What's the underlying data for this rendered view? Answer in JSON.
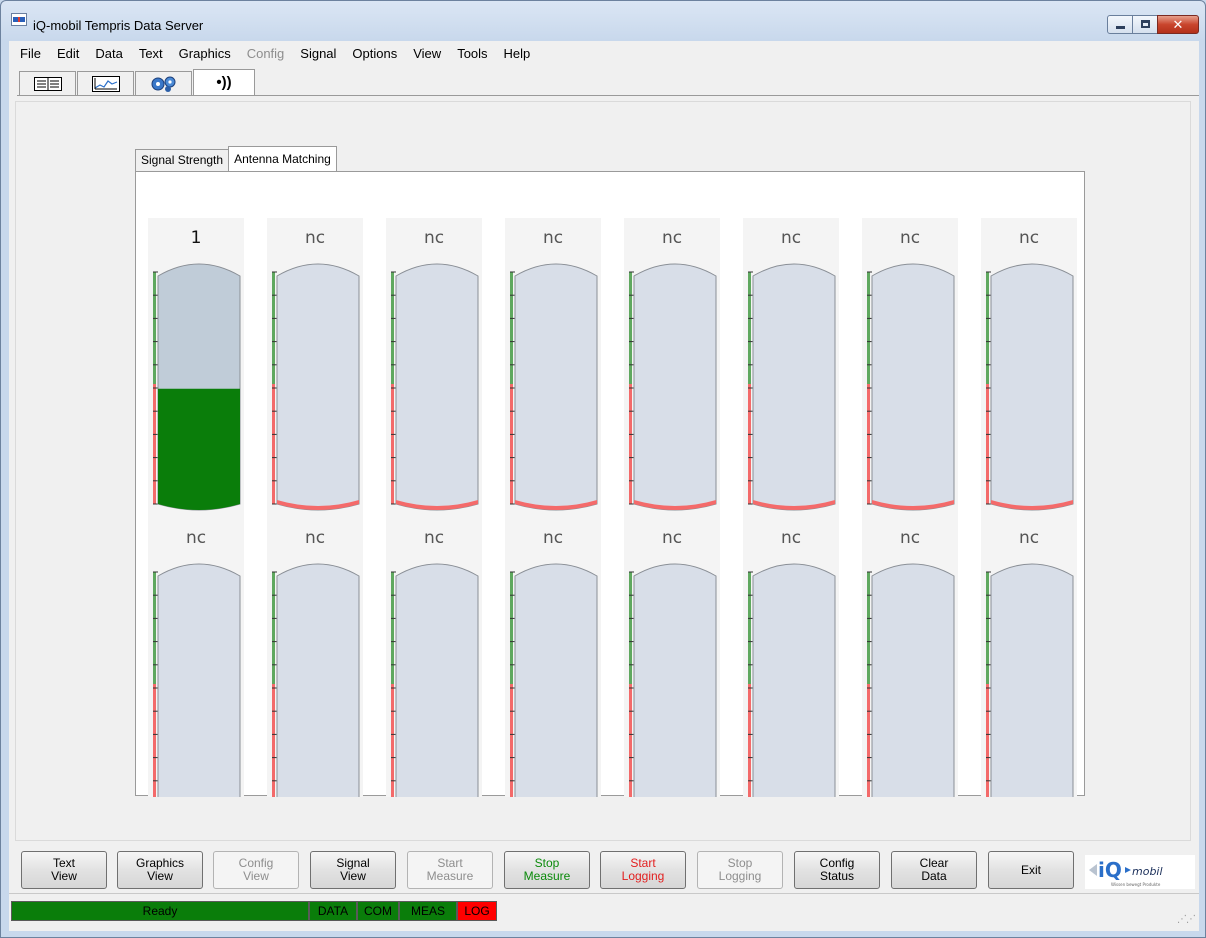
{
  "window": {
    "title": "iQ-mobil Tempris Data Server"
  },
  "menu": [
    {
      "label": "File",
      "enabled": true
    },
    {
      "label": "Edit",
      "enabled": true
    },
    {
      "label": "Data",
      "enabled": true
    },
    {
      "label": "Text",
      "enabled": true
    },
    {
      "label": "Graphics",
      "enabled": true
    },
    {
      "label": "Config",
      "enabled": false
    },
    {
      "label": "Signal",
      "enabled": true
    },
    {
      "label": "Options",
      "enabled": true
    },
    {
      "label": "View",
      "enabled": true
    },
    {
      "label": "Tools",
      "enabled": true
    },
    {
      "label": "Help",
      "enabled": true
    }
  ],
  "view_tabs": [
    {
      "name": "table-view-tab",
      "icon": "table-icon",
      "active": false
    },
    {
      "name": "graph-view-tab",
      "icon": "chart-icon",
      "active": false
    },
    {
      "name": "config-view-tab",
      "icon": "gears-icon",
      "active": false
    },
    {
      "name": "signal-view-tab",
      "icon": "antenna-icon",
      "label": "•))",
      "active": true
    }
  ],
  "subtabs": [
    {
      "label": "Signal Strength",
      "active": false
    },
    {
      "label": "Antenna Matching",
      "active": true
    }
  ],
  "gauges": [
    {
      "label": "1",
      "level": 0.48
    },
    {
      "label": "nc",
      "level": 0
    },
    {
      "label": "nc",
      "level": 0
    },
    {
      "label": "nc",
      "level": 0
    },
    {
      "label": "nc",
      "level": 0
    },
    {
      "label": "nc",
      "level": 0
    },
    {
      "label": "nc",
      "level": 0
    },
    {
      "label": "nc",
      "level": 0
    },
    {
      "label": "nc",
      "level": 0
    },
    {
      "label": "nc",
      "level": 0
    },
    {
      "label": "nc",
      "level": 0
    },
    {
      "label": "nc",
      "level": 0
    },
    {
      "label": "nc",
      "level": 0
    },
    {
      "label": "nc",
      "level": 0
    },
    {
      "label": "nc",
      "level": 0
    },
    {
      "label": "nc",
      "level": 0
    }
  ],
  "gauge_colors": {
    "scale_good": "#5fa85f",
    "scale_bad": "#f36a6a",
    "empty_body": "#d8dee8",
    "active_upper": "#c0ccd8",
    "fill_good": "#0a7d0a",
    "base_red": "#f46a6a"
  },
  "buttons": [
    {
      "name": "text-view-button",
      "label": "Text\nView",
      "state": "enabled"
    },
    {
      "name": "graphics-view-button",
      "label": "Graphics\nView",
      "state": "enabled"
    },
    {
      "name": "config-view-button",
      "label": "Config\nView",
      "state": "disabled"
    },
    {
      "name": "signal-view-button",
      "label": "Signal\nView",
      "state": "enabled"
    },
    {
      "name": "start-measure-button",
      "label": "Start\nMeasure",
      "state": "disabled"
    },
    {
      "name": "stop-measure-button",
      "label": "Stop\nMeasure",
      "state": "green"
    },
    {
      "name": "start-logging-button",
      "label": "Start\nLogging",
      "state": "red"
    },
    {
      "name": "stop-logging-button",
      "label": "Stop\nLogging",
      "state": "disabled"
    },
    {
      "name": "config-status-button",
      "label": "Config\nStatus",
      "state": "enabled"
    },
    {
      "name": "clear-data-button",
      "label": "Clear\nData",
      "state": "enabled"
    },
    {
      "name": "exit-button",
      "label": "Exit",
      "state": "enabled"
    }
  ],
  "logo": {
    "brand": "iQ",
    "suffix": "mobil",
    "tagline": "Wissen bewegt Produkte"
  },
  "status": {
    "text": "Ready",
    "indicators": [
      {
        "label": "DATA",
        "color": "#0a7d0a"
      },
      {
        "label": "COM",
        "color": "#0a7d0a"
      },
      {
        "label": "MEAS",
        "color": "#0a7d0a"
      },
      {
        "label": "LOG",
        "color": "#ff0000"
      }
    ],
    "ready_color": "#0a7d0a"
  }
}
